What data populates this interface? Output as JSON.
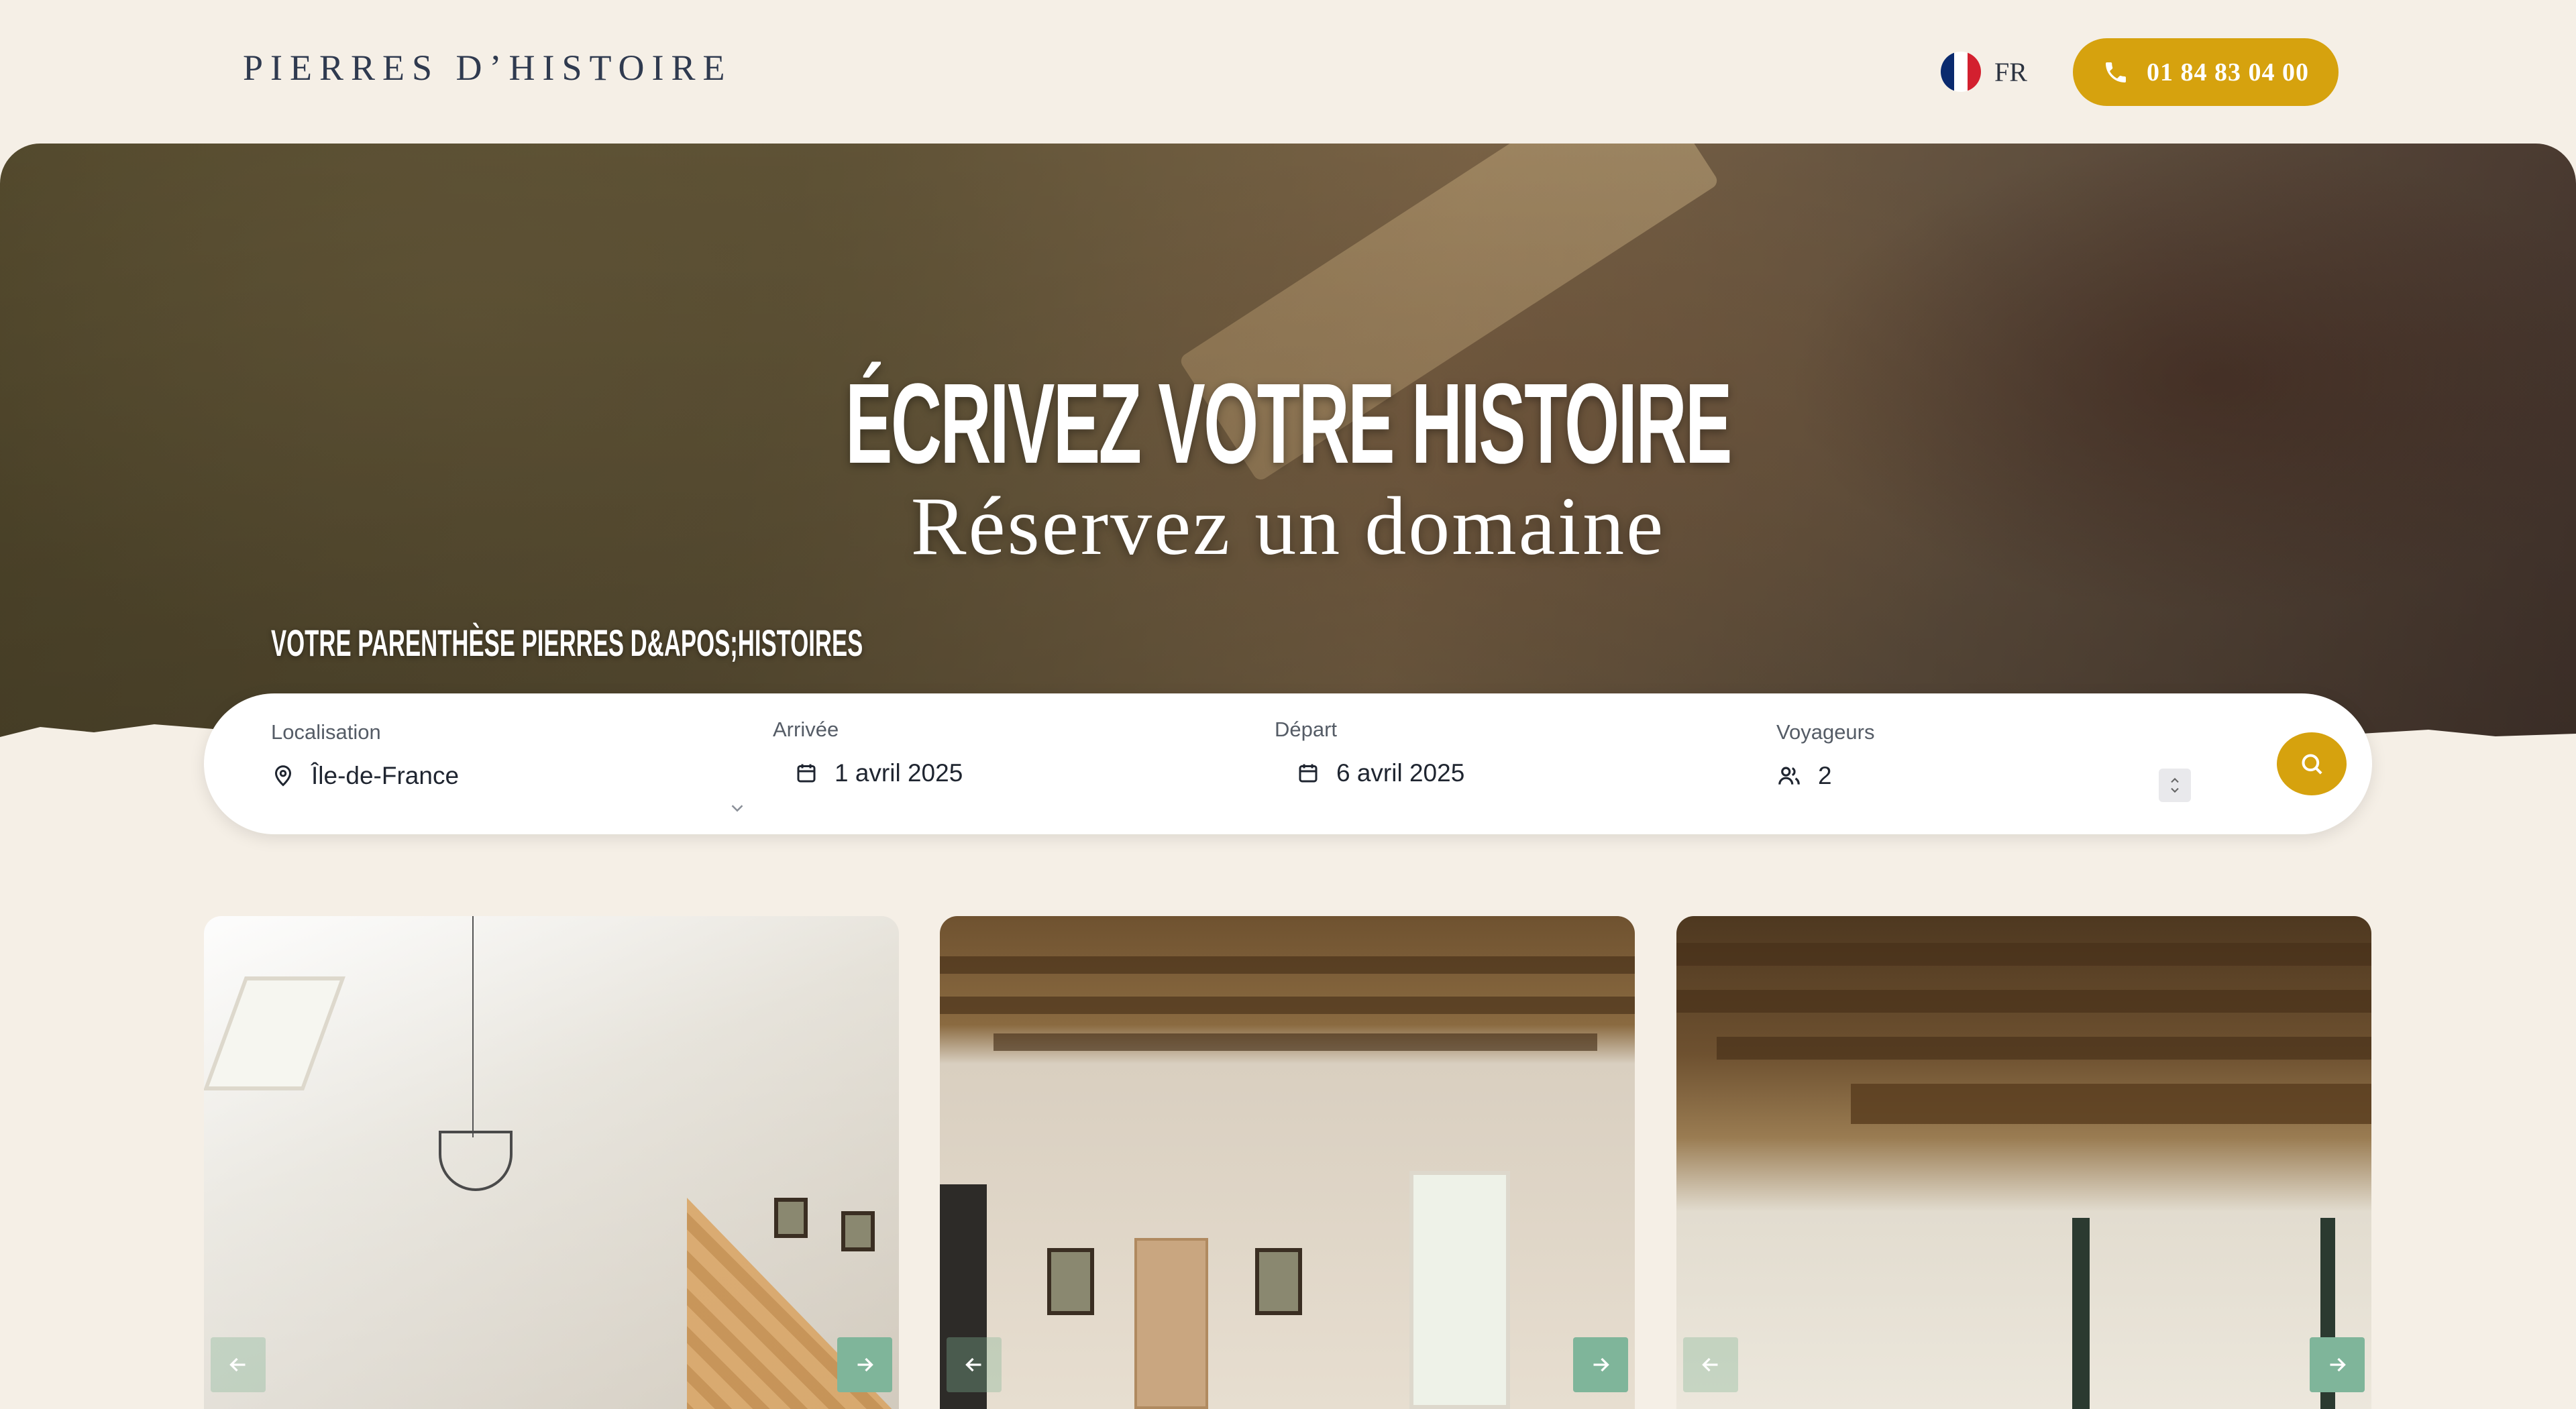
{
  "header": {
    "brand": "PIERRES D’HISTOIRE",
    "language": "FR",
    "phone": "01 84 83 04 00"
  },
  "hero": {
    "title": "ÉCRIVEZ VOTRE HISTOIRE",
    "subtitle": "Réservez un domaine",
    "tagline": "VOTRE PARENTHÈSE PIERRES D&APOS;HISTOIRES"
  },
  "search": {
    "location_label": "Localisation",
    "location_value": "Île-de-France",
    "arrival_label": "Arrivée",
    "arrival_value": "1 avril 2025",
    "departure_label": "Départ",
    "departure_value": "6 avril 2025",
    "travelers_label": "Voyageurs",
    "travelers_value": "2"
  },
  "colors": {
    "background": "#f5efe6",
    "accent": "#d6a20e",
    "nav_button": "#7fb59a",
    "text_dark": "#2f3a4f"
  },
  "icons": {
    "phone": "phone-icon",
    "location": "map-pin-icon",
    "calendar": "calendar-icon",
    "travelers": "users-icon",
    "search": "search-icon",
    "carousel_prev": "arrow-left-icon",
    "carousel_next": "arrow-right-icon"
  },
  "cards": [
    {
      "id": "card-1"
    },
    {
      "id": "card-2"
    },
    {
      "id": "card-3"
    }
  ]
}
